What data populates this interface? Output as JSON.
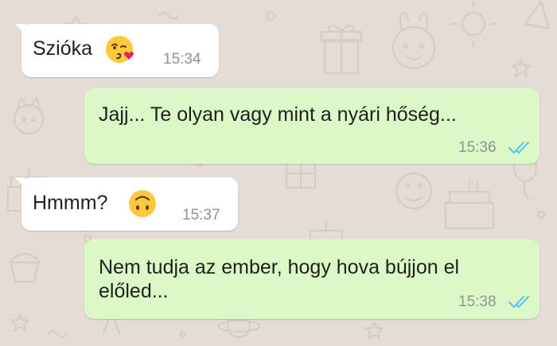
{
  "chat": {
    "messages": [
      {
        "direction": "incoming",
        "text": "Szióka",
        "emoji": "kissing-face-with-heart-emoji",
        "time": "15:34"
      },
      {
        "direction": "outgoing",
        "text": "Jajj... Te olyan vagy mint a nyári hőség...",
        "time": "15:36",
        "status": "read"
      },
      {
        "direction": "incoming",
        "text": "Hmmm?",
        "emoji": "upside-down-face-emoji",
        "time": "15:37"
      },
      {
        "direction": "outgoing",
        "text_line1": "Nem tudja az ember, hogy hova bújjon el",
        "text_line2": "előled...",
        "time": "15:38",
        "status": "read"
      }
    ]
  },
  "colors": {
    "background": "#e5ddd5",
    "incoming_bubble": "#ffffff",
    "outgoing_bubble": "#dcf8c6",
    "read_ticks": "#4fc3f7",
    "timestamp": "#8e9590"
  }
}
